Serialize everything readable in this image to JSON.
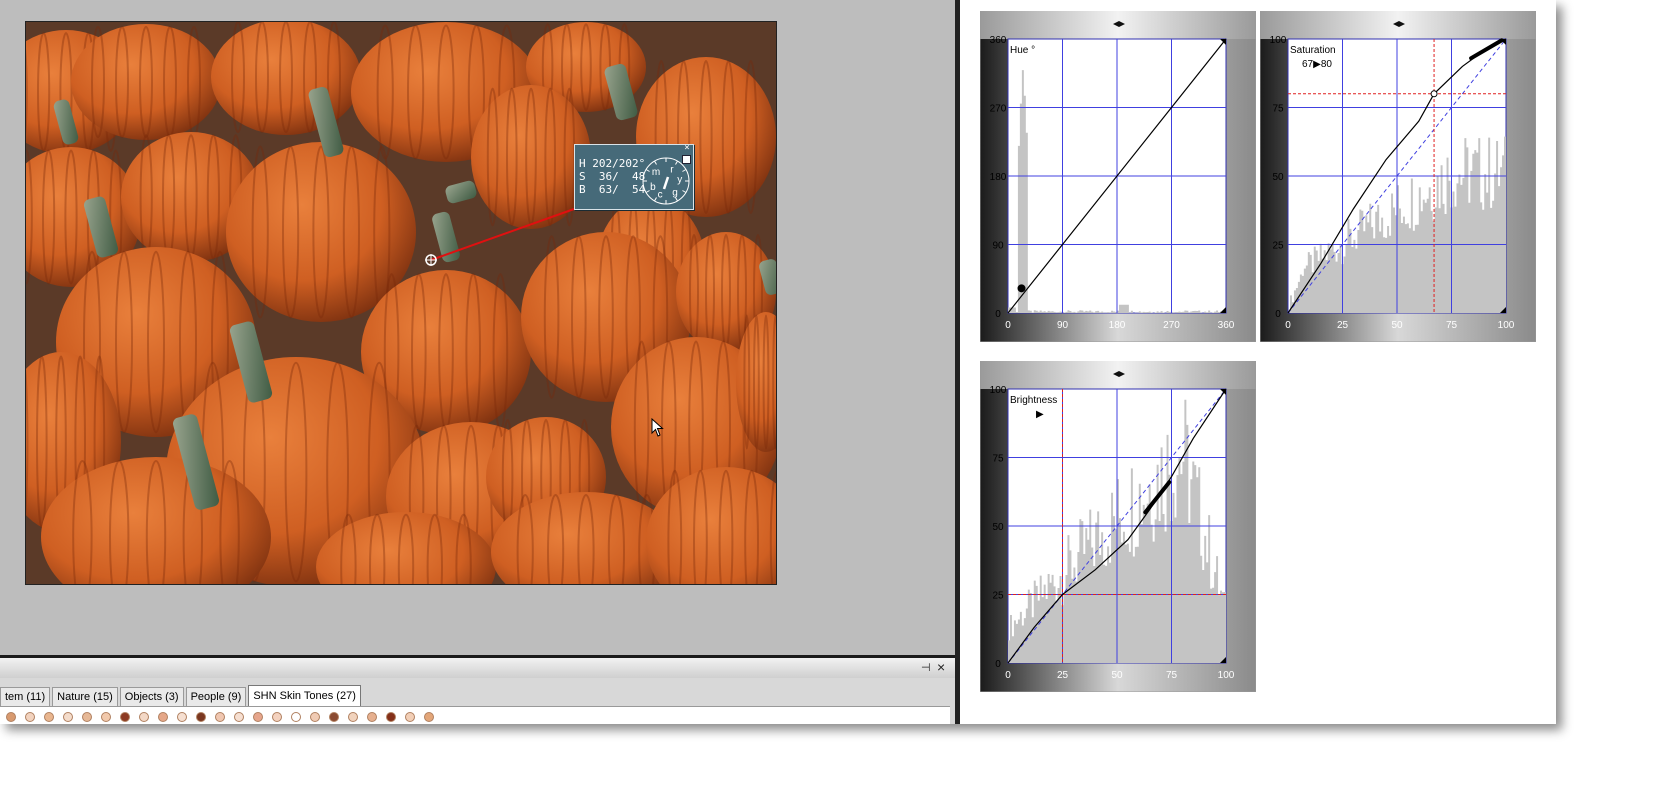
{
  "readout": {
    "h": "H 202/202°",
    "s": "S  36/  48",
    "b": "B  63/  54",
    "close_label": "×",
    "wheel_letters": [
      "r",
      "y",
      "g",
      "c",
      "b",
      "m"
    ]
  },
  "panels": {
    "hue": {
      "label": "Hue °",
      "y_ticks": [
        "360",
        "270",
        "180",
        "90",
        "0"
      ],
      "x_ticks": [
        "0",
        "90",
        "180",
        "270",
        "360"
      ]
    },
    "saturation": {
      "label": "Saturation",
      "value_text": "67▶80",
      "y_ticks": [
        "100",
        "75",
        "50",
        "25",
        "0"
      ],
      "x_ticks": [
        "0",
        "25",
        "50",
        "75",
        "100"
      ]
    },
    "brightness": {
      "label": "Brightness",
      "value_text": "▶",
      "y_ticks": [
        "100",
        "75",
        "50",
        "25",
        "0"
      ],
      "x_ticks": [
        "0",
        "25",
        "50",
        "75",
        "100"
      ]
    }
  },
  "bottom_panel": {
    "pin_label": "⊣",
    "close_label": "×",
    "tabs": [
      {
        "label": "tem (11)"
      },
      {
        "label": "Nature (15)"
      },
      {
        "label": "Objects (3)"
      },
      {
        "label": "People (9)"
      },
      {
        "label": "SHN Skin Tones (27)"
      }
    ],
    "swatch_colors": [
      "#d89a6f",
      "#f2d3bf",
      "#e9b68f",
      "#f4dccb",
      "#e6b896",
      "#f1c9ac",
      "#8c3a22",
      "#f3d8c6",
      "#e5a788",
      "#f6e0d2",
      "#7a3720",
      "#f0c7b1",
      "#f6dfd1",
      "#e6a58c",
      "#f4d2bf",
      "#ffffff",
      "#f0cbb4",
      "#8a4a31",
      "#f1d3bd",
      "#e6b08f",
      "#843019",
      "#f2cfb7",
      "#e3a679"
    ],
    "active_tab": "SHN Skin Tones (27)"
  },
  "colors": {
    "readout_bg": "#466a79",
    "grid_line": "#4040e0",
    "histogram": "#c4c4c4",
    "probe_line": "#e01010",
    "pane_bg": "#bdbdbd"
  }
}
